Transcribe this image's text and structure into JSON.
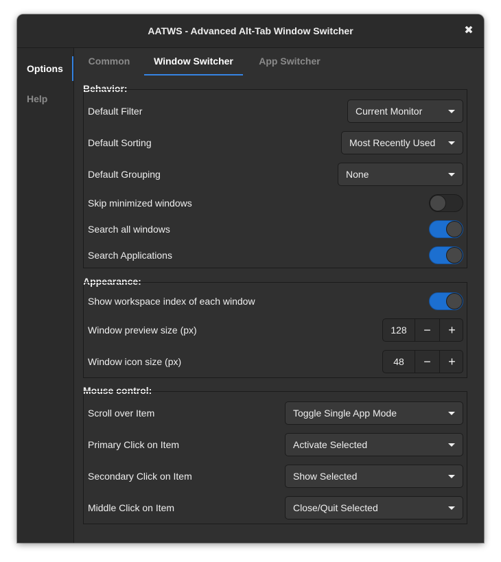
{
  "window": {
    "title": "AATWS - Advanced Alt-Tab Window Switcher",
    "close_glyph": "✖"
  },
  "sidebar": {
    "items": [
      {
        "label": "Options",
        "active": true
      },
      {
        "label": "Help",
        "active": false
      }
    ]
  },
  "tabs": [
    {
      "label": "Common",
      "active": false
    },
    {
      "label": "Window Switcher",
      "active": true
    },
    {
      "label": "App Switcher",
      "active": false
    }
  ],
  "behavior": {
    "title": "Behavior:",
    "default_filter": {
      "label": "Default Filter",
      "value": "Current Monitor"
    },
    "default_sorting": {
      "label": "Default Sorting",
      "value": "Most Recently Used"
    },
    "default_grouping": {
      "label": "Default Grouping",
      "value": "None"
    },
    "skip_minimized": {
      "label": "Skip minimized windows",
      "on": false
    },
    "search_all": {
      "label": "Search all windows",
      "on": true
    },
    "search_apps": {
      "label": "Search Applications",
      "on": true
    }
  },
  "appearance": {
    "title": "Appearance:",
    "show_ws_index": {
      "label": "Show workspace index of each window",
      "on": true
    },
    "preview_size": {
      "label": "Window preview size (px)",
      "value": "128",
      "minus": "−",
      "plus": "+"
    },
    "icon_size": {
      "label": "Window icon size (px)",
      "value": "48",
      "minus": "−",
      "plus": "+"
    }
  },
  "mouse": {
    "title": "Mouse control:",
    "scroll": {
      "label": "Scroll over Item",
      "value": "Toggle Single App Mode"
    },
    "primary": {
      "label": "Primary Click on Item",
      "value": "Activate Selected"
    },
    "secondary": {
      "label": "Secondary Click on Item",
      "value": "Show Selected"
    },
    "middle": {
      "label": "Middle Click on Item",
      "value": "Close/Quit Selected"
    }
  },
  "colors": {
    "accent": "#3584e4",
    "switch_on": "#1c6fd0",
    "bg": "#303030"
  }
}
